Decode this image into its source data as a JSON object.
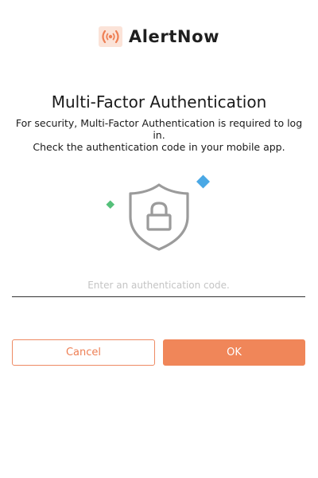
{
  "brand": {
    "name": "AlertNow",
    "logo_icon": "radio-wave-icon",
    "accent_color": "#f08659"
  },
  "heading": {
    "title": "Multi-Factor Authentication",
    "line1": "For security, Multi-Factor Authentication is required to log in.",
    "line2": "Check the authentication code in your mobile app."
  },
  "illustration": {
    "icon": "shield-lock-icon",
    "decorations": [
      "green-diamond",
      "blue-diamond"
    ]
  },
  "form": {
    "code_value": "",
    "code_placeholder": "Enter an authentication code."
  },
  "actions": {
    "cancel_label": "Cancel",
    "ok_label": "OK"
  }
}
